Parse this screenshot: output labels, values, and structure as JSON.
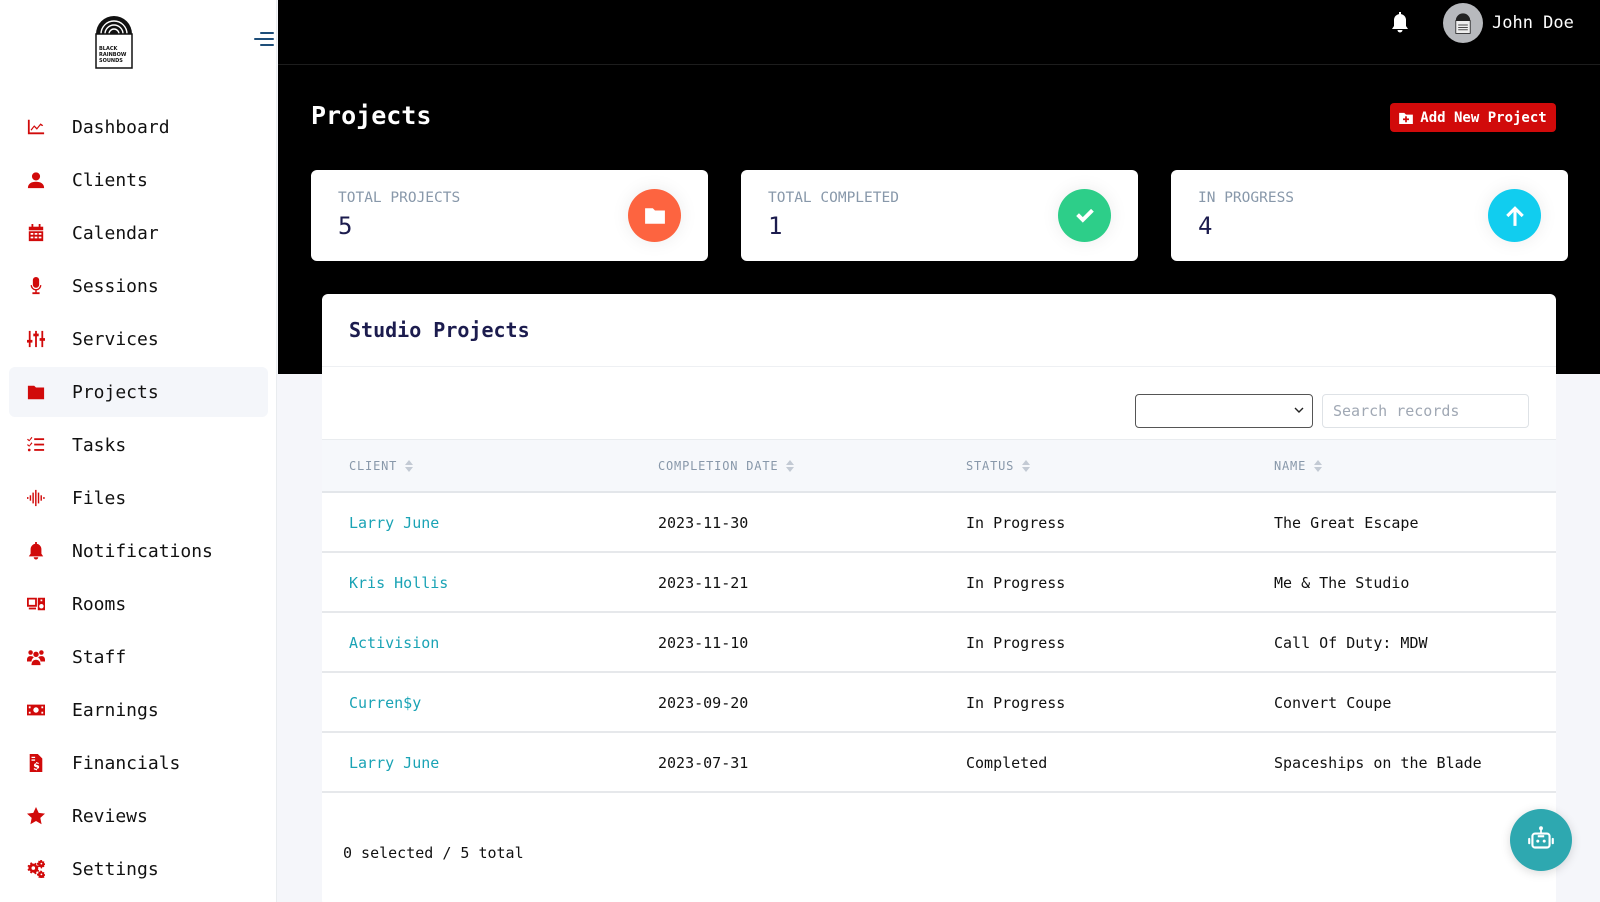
{
  "brand": {
    "logo_lines": [
      "BLACK",
      "RAINBOW",
      "SOUNDS"
    ]
  },
  "sidebar": {
    "items": [
      {
        "label": "Dashboard",
        "icon": "chart-line-icon",
        "active": false
      },
      {
        "label": "Clients",
        "icon": "user-icon",
        "active": false
      },
      {
        "label": "Calendar",
        "icon": "calendar-icon",
        "active": false
      },
      {
        "label": "Sessions",
        "icon": "microphone-icon",
        "active": false
      },
      {
        "label": "Services",
        "icon": "sliders-icon",
        "active": false
      },
      {
        "label": "Projects",
        "icon": "folder-icon",
        "active": true
      },
      {
        "label": "Tasks",
        "icon": "checklist-icon",
        "active": false
      },
      {
        "label": "Files",
        "icon": "waveform-icon",
        "active": false
      },
      {
        "label": "Notifications",
        "icon": "bell-icon",
        "active": false
      },
      {
        "label": "Rooms",
        "icon": "rooms-icon",
        "active": false
      },
      {
        "label": "Staff",
        "icon": "users-icon",
        "active": false
      },
      {
        "label": "Earnings",
        "icon": "money-bill-icon",
        "active": false
      },
      {
        "label": "Financials",
        "icon": "invoice-dollar-icon",
        "active": false
      },
      {
        "label": "Reviews",
        "icon": "star-icon",
        "active": false
      },
      {
        "label": "Settings",
        "icon": "gears-icon",
        "active": false
      }
    ]
  },
  "header": {
    "user_name": "John Doe",
    "page_title": "Projects",
    "add_button_label": "Add New Project"
  },
  "stats": [
    {
      "label": "TOTAL PROJECTS",
      "value": "5",
      "icon": "folder-icon",
      "color": "#fd6440"
    },
    {
      "label": "TOTAL COMPLETED",
      "value": "1",
      "icon": "check-icon",
      "color": "#2dce89"
    },
    {
      "label": "IN PROGRESS",
      "value": "4",
      "icon": "arrow-up-icon",
      "color": "#11cdef"
    }
  ],
  "projects_table": {
    "title": "Studio Projects",
    "filter_value": "",
    "search_placeholder": "Search records",
    "columns": [
      "CLIENT",
      "COMPLETION DATE",
      "STATUS",
      "NAME"
    ],
    "rows": [
      {
        "client": "Larry June",
        "completion_date": "2023-11-30",
        "status": "In Progress",
        "name": "The Great Escape"
      },
      {
        "client": "Kris Hollis",
        "completion_date": "2023-11-21",
        "status": "In Progress",
        "name": "Me & The Studio"
      },
      {
        "client": "Activision",
        "completion_date": "2023-11-10",
        "status": "In Progress",
        "name": "Call Of Duty: MDW"
      },
      {
        "client": "Curren$y",
        "completion_date": "2023-09-20",
        "status": "In Progress",
        "name": "Convert Coupe"
      },
      {
        "client": "Larry June",
        "completion_date": "2023-07-31",
        "status": "Completed",
        "name": "Spaceships on the Blade"
      }
    ],
    "footer_text": "0 selected / 5 total"
  },
  "colors": {
    "accent_red": "#d10a0a",
    "link_teal": "#1aa3b5",
    "assistant_teal": "#2ea8b0"
  }
}
